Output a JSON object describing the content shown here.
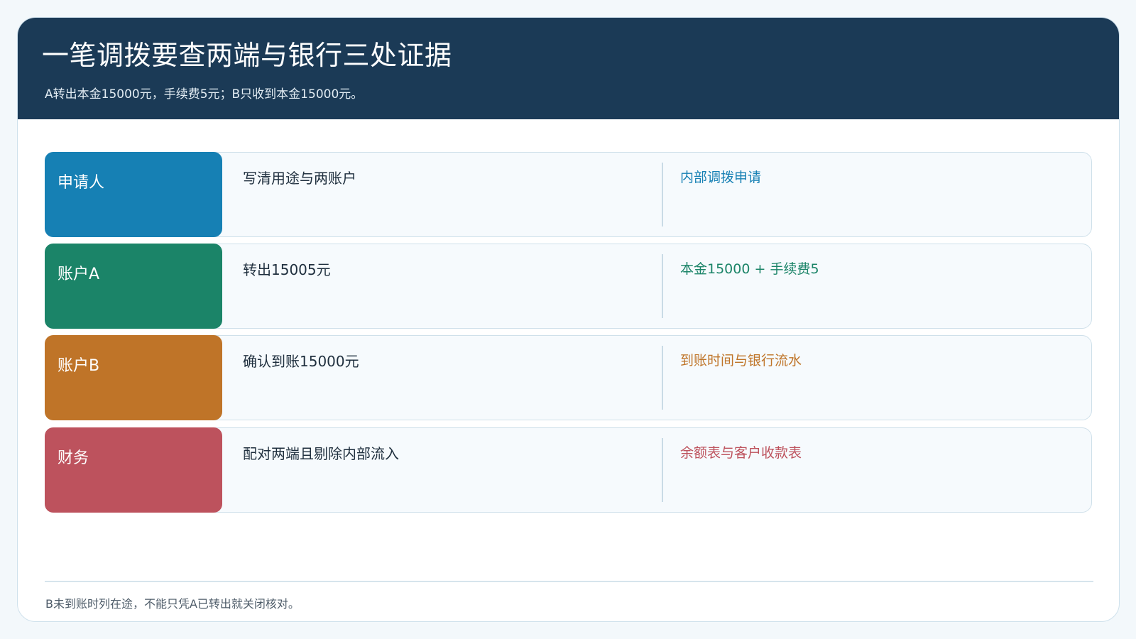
{
  "header": {
    "title": "一笔调拨要查两端与银行三处证据",
    "subtitle": "A转出本金15000元，手续费5元；B只收到本金15000元。"
  },
  "rows": [
    {
      "role": "申请人",
      "action": "写清用途与两账户",
      "evidence": "内部调拨申请",
      "color": "#1680b4"
    },
    {
      "role": "账户A",
      "action": "转出15005元",
      "evidence": "本金15000 + 手续费5",
      "color": "#1b8468"
    },
    {
      "role": "账户B",
      "action": "确认到账15000元",
      "evidence": "到账时间与银行流水",
      "color": "#bf7428"
    },
    {
      "role": "财务",
      "action": "配对两端且剔除内部流入",
      "evidence": "余额表与客户收款表",
      "color": "#bd525d"
    }
  ],
  "footer": {
    "note": "B未到账时列在途，不能只凭A已转出就关闭核对。"
  }
}
